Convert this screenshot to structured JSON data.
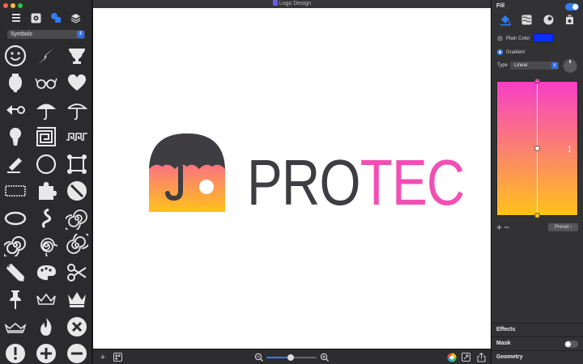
{
  "window": {
    "title": "Logo Design"
  },
  "sidebar": {
    "category": "Symbols",
    "tools": [
      "list-icon",
      "gear-icon",
      "shapes-icon",
      "layers-icon"
    ],
    "symbols": [
      "smiley",
      "lightning",
      "trophy-vase",
      "amphora",
      "glasses",
      "heart",
      "arrow-cross",
      "umbrella",
      "umbrella-outline",
      "keyhole",
      "spiral-square",
      "greek-key",
      "eraser",
      "circle-outline",
      "ornate-frame",
      "ornate-rect",
      "puzzle-piece",
      "no-sign",
      "ellipse-outline",
      "swirl",
      "spiral",
      "spiral-2",
      "spiral-3",
      "spiral-4",
      "pencil",
      "palette",
      "scissors",
      "push-pin",
      "crown-outline",
      "crown",
      "crown-small",
      "flame",
      "close-circle",
      "exclamation-circle",
      "add-circle",
      "minus-circle"
    ]
  },
  "canvas": {
    "logo_letter": "J",
    "logo_text_dark": "PRO",
    "logo_text_accent": "TEC",
    "colors": {
      "text_dark": "#3e3e42",
      "text_accent": "#f24fb4",
      "grad_top": "#f73fc8",
      "grad_bottom": "#ffc21a"
    }
  },
  "bottombar": {
    "add_label": "+",
    "zoom_fraction": 0.48
  },
  "inspector": {
    "section_fill": "Fill",
    "fill_enabled": true,
    "plain_color_label": "Plain Color",
    "plain_color": "#0c2cfb",
    "gradient_label": "Gradient",
    "gradient_selected": true,
    "type_label": "Type",
    "type_value": "Linear",
    "gradient_top": "#f73fc8",
    "gradient_bottom": "#ffc21a",
    "add_stop": "+",
    "remove_stop": "−",
    "preset_label": "Preset",
    "section_effects": "Effects",
    "section_mask": "Mask",
    "mask_enabled": false,
    "section_geometry": "Geometry"
  }
}
